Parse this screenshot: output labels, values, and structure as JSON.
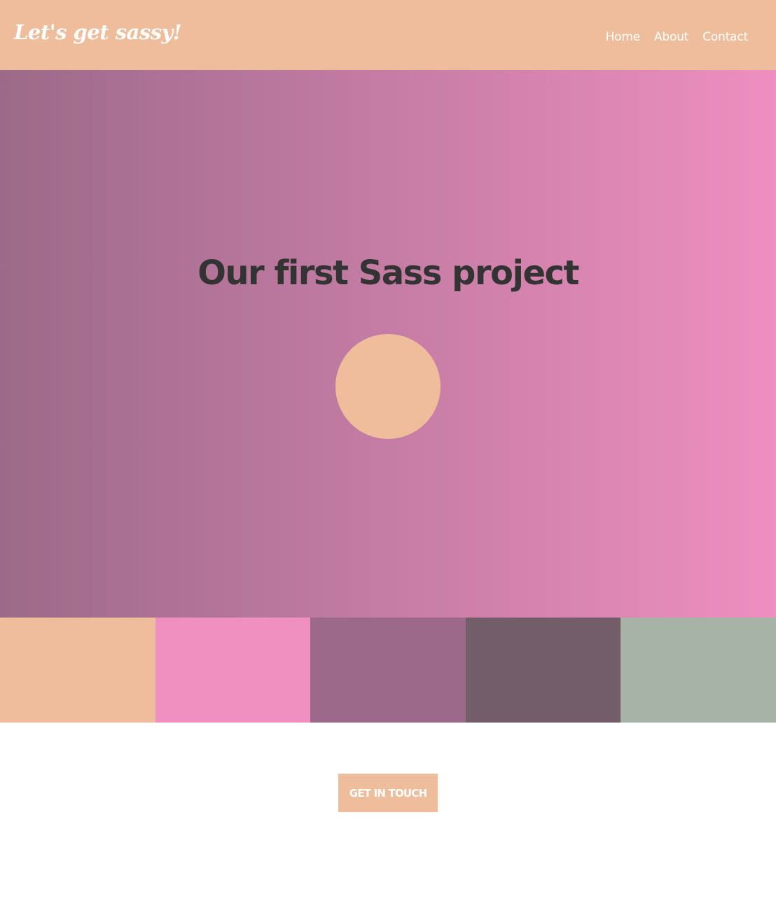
{
  "header": {
    "logo_text": "Let's get sassy!",
    "background": "#eebd9c",
    "nav": [
      {
        "label": "Home"
      },
      {
        "label": "About"
      },
      {
        "label": "Contact"
      }
    ]
  },
  "hero": {
    "title": "Our first Sass project",
    "gradient_start": "#9c6a88",
    "gradient_end": "#ee8fc0",
    "circle_color": "#eebd9c"
  },
  "swatches": [
    {
      "color": "#eebd9c"
    },
    {
      "color": "#ee8fc0"
    },
    {
      "color": "#9c6a88"
    },
    {
      "color": "#735d68"
    },
    {
      "color": "#a8b3a8"
    }
  ],
  "cta": {
    "label": "GET IN TOUCH"
  }
}
